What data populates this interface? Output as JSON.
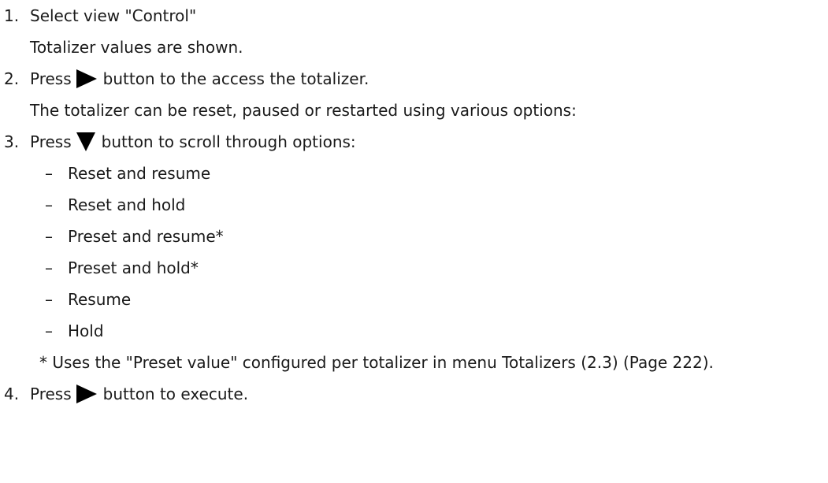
{
  "steps": [
    {
      "number": "1.",
      "text": "Select view \"Control\""
    },
    {
      "number": "2.",
      "before": "Press",
      "after": "button to the access the totalizer."
    },
    {
      "number": "3.",
      "before": "Press",
      "after": "button to scroll through options:"
    },
    {
      "number": "4.",
      "before": "Press",
      "after": "button to execute."
    }
  ],
  "results": {
    "step1": "Totalizer values are shown.",
    "step2": "The totalizer can be reset, paused or restarted using various options:"
  },
  "dash": "–",
  "options": [
    "Reset and resume",
    "Reset and hold",
    "Preset and resume*",
    "Preset and hold*",
    "Resume",
    "Hold"
  ],
  "footnote": "* Uses the \"Preset value\" configured per totalizer in menu Totalizers (2.3) (Page 222).",
  "icons": {
    "right": "right-triangle-icon",
    "down": "down-triangle-icon"
  },
  "colors": {
    "text": "#1a1a1a",
    "icon": "#000000"
  }
}
